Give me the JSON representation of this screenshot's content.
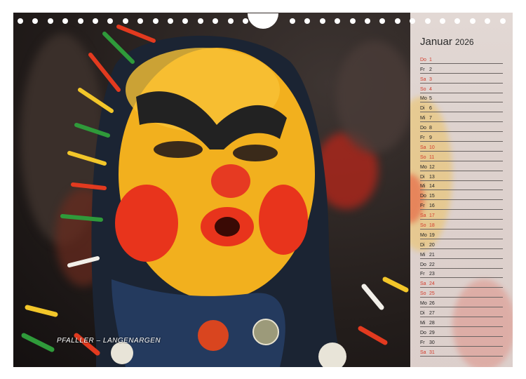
{
  "calendar": {
    "month": "Januar",
    "year": "2026",
    "caption": "PFALLLER – LANGENARGEN",
    "days": [
      {
        "dow": "Do",
        "num": "1",
        "weekend": true
      },
      {
        "dow": "Fr",
        "num": "2",
        "weekend": false
      },
      {
        "dow": "Sa",
        "num": "3",
        "weekend": true
      },
      {
        "dow": "So",
        "num": "4",
        "weekend": true
      },
      {
        "dow": "Mo",
        "num": "5",
        "weekend": false
      },
      {
        "dow": "Di",
        "num": "6",
        "weekend": false
      },
      {
        "dow": "Mi",
        "num": "7",
        "weekend": false
      },
      {
        "dow": "Do",
        "num": "8",
        "weekend": false
      },
      {
        "dow": "Fr",
        "num": "9",
        "weekend": false
      },
      {
        "dow": "Sa",
        "num": "10",
        "weekend": true
      },
      {
        "dow": "So",
        "num": "11",
        "weekend": true
      },
      {
        "dow": "Mo",
        "num": "12",
        "weekend": false
      },
      {
        "dow": "Di",
        "num": "13",
        "weekend": false
      },
      {
        "dow": "Mi",
        "num": "14",
        "weekend": false
      },
      {
        "dow": "Do",
        "num": "15",
        "weekend": false
      },
      {
        "dow": "Fr",
        "num": "16",
        "weekend": false
      },
      {
        "dow": "Sa",
        "num": "17",
        "weekend": true
      },
      {
        "dow": "So",
        "num": "18",
        "weekend": true
      },
      {
        "dow": "Mo",
        "num": "19",
        "weekend": false
      },
      {
        "dow": "Di",
        "num": "20",
        "weekend": false
      },
      {
        "dow": "Mi",
        "num": "21",
        "weekend": false
      },
      {
        "dow": "Do",
        "num": "22",
        "weekend": false
      },
      {
        "dow": "Fr",
        "num": "23",
        "weekend": false
      },
      {
        "dow": "Sa",
        "num": "24",
        "weekend": true
      },
      {
        "dow": "So",
        "num": "25",
        "weekend": true
      },
      {
        "dow": "Mo",
        "num": "26",
        "weekend": false
      },
      {
        "dow": "Di",
        "num": "27",
        "weekend": false
      },
      {
        "dow": "Mi",
        "num": "28",
        "weekend": false
      },
      {
        "dow": "Do",
        "num": "29",
        "weekend": false
      },
      {
        "dow": "Fr",
        "num": "30",
        "weekend": false
      },
      {
        "dow": "Sa",
        "num": "31",
        "weekend": true
      }
    ]
  },
  "colors": {
    "weekend": "#d23c2c",
    "weekday": "#222222",
    "mask_yellow": "#f2b01e",
    "mask_red": "#e8341c"
  }
}
